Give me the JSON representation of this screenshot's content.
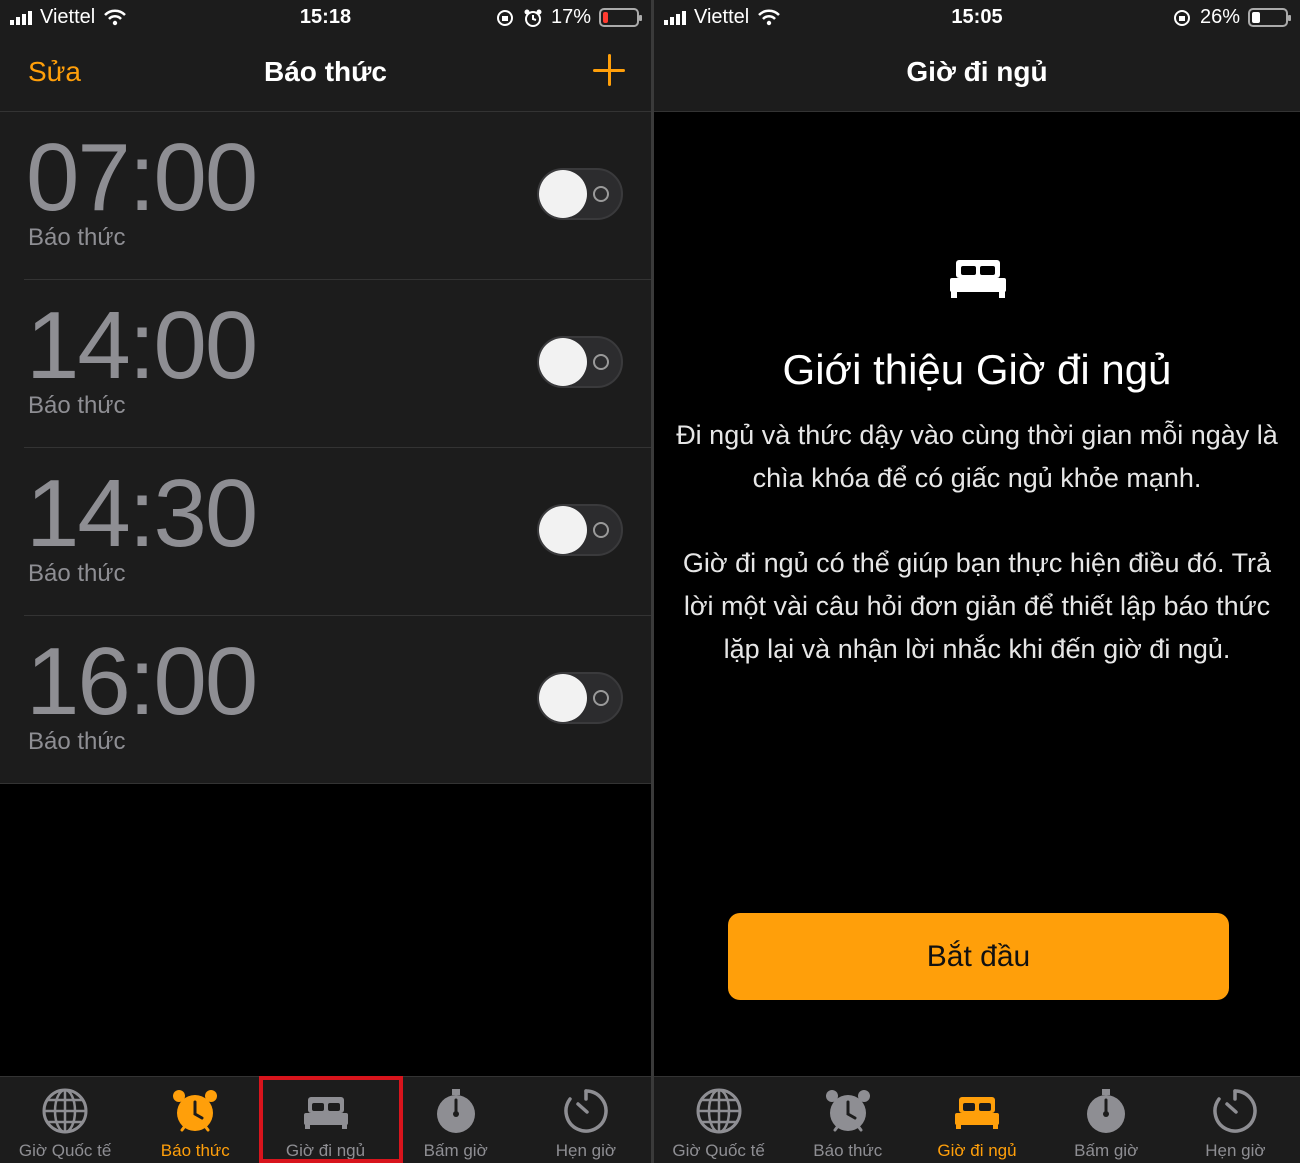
{
  "left": {
    "status": {
      "carrier": "Viettel",
      "time": "15:18",
      "battery": "17%",
      "battery_level": 0.17,
      "battery_color": "#ff3b30"
    },
    "nav": {
      "edit": "Sửa",
      "title": "Báo thức"
    },
    "alarms": [
      {
        "time": "07:00",
        "label": "Báo thức",
        "enabled": false
      },
      {
        "time": "14:00",
        "label": "Báo thức",
        "enabled": false
      },
      {
        "time": "14:30",
        "label": "Báo thức",
        "enabled": false
      },
      {
        "time": "16:00",
        "label": "Báo thức",
        "enabled": false
      }
    ],
    "tabs": [
      {
        "label": "Giờ Quốc tế",
        "icon": "globe-icon"
      },
      {
        "label": "Báo thức",
        "icon": "alarm-clock-icon"
      },
      {
        "label": "Giờ đi ngủ",
        "icon": "bed-icon"
      },
      {
        "label": "Bấm giờ",
        "icon": "stopwatch-icon"
      },
      {
        "label": "Hẹn giờ",
        "icon": "timer-icon"
      }
    ],
    "active_tab": "Báo thức"
  },
  "right": {
    "status": {
      "carrier": "Viettel",
      "time": "15:05",
      "battery": "26%",
      "battery_level": 0.26,
      "battery_color": "#ffffff"
    },
    "nav": {
      "title": "Giờ đi ngủ"
    },
    "intro": {
      "icon": "bed-icon",
      "title": "Giới thiệu Giờ đi ngủ",
      "p1": "Đi ngủ và thức dậy vào cùng thời gian mỗi ngày là chìa khóa để có giấc ngủ khỏe mạnh.",
      "p2": "Giờ đi ngủ có thể giúp bạn thực hiện điều đó. Trả lời một vài câu hỏi đơn giản để thiết lập báo thức lặp lại và nhận lời nhắc khi đến giờ đi ngủ."
    },
    "start_button": "Bắt đầu",
    "tabs": [
      {
        "label": "Giờ Quốc tế",
        "icon": "globe-icon"
      },
      {
        "label": "Báo thức",
        "icon": "alarm-clock-icon"
      },
      {
        "label": "Giờ đi ngủ",
        "icon": "bed-icon"
      },
      {
        "label": "Bấm giờ",
        "icon": "stopwatch-icon"
      },
      {
        "label": "Hẹn giờ",
        "icon": "timer-icon"
      }
    ],
    "active_tab": "Giờ đi ngủ"
  },
  "colors": {
    "accent": "#ff9f0a",
    "highlight": "#d8141c",
    "inactive": "#8e8e93"
  }
}
